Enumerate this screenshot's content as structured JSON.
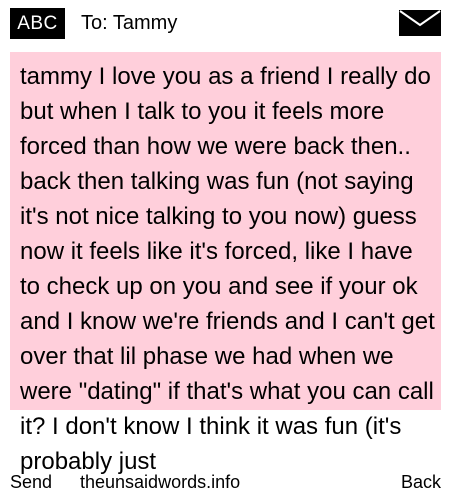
{
  "header": {
    "mode_badge": "ABC",
    "recipient_label": "To: Tammy"
  },
  "message": {
    "body": "tammy I love you as a friend I really do but when I talk to you it feels more forced than how we were back then.. back then talking was fun (not saying it's not nice talking to you now) guess now it feels like it's forced, like I have to check up on you and see if your ok and I know we're friends and I can't get over that lil phase we had when we were \"dating\" if that's what you can call it? I don't know I think it was fun (it's probably just"
  },
  "footer": {
    "send_label": "Send",
    "watermark": "theunsaidwords.info",
    "back_label": "Back"
  },
  "colors": {
    "message_background": "#ffcfdb",
    "badge_background": "#000000"
  },
  "icons": {
    "envelope": "envelope-icon"
  }
}
